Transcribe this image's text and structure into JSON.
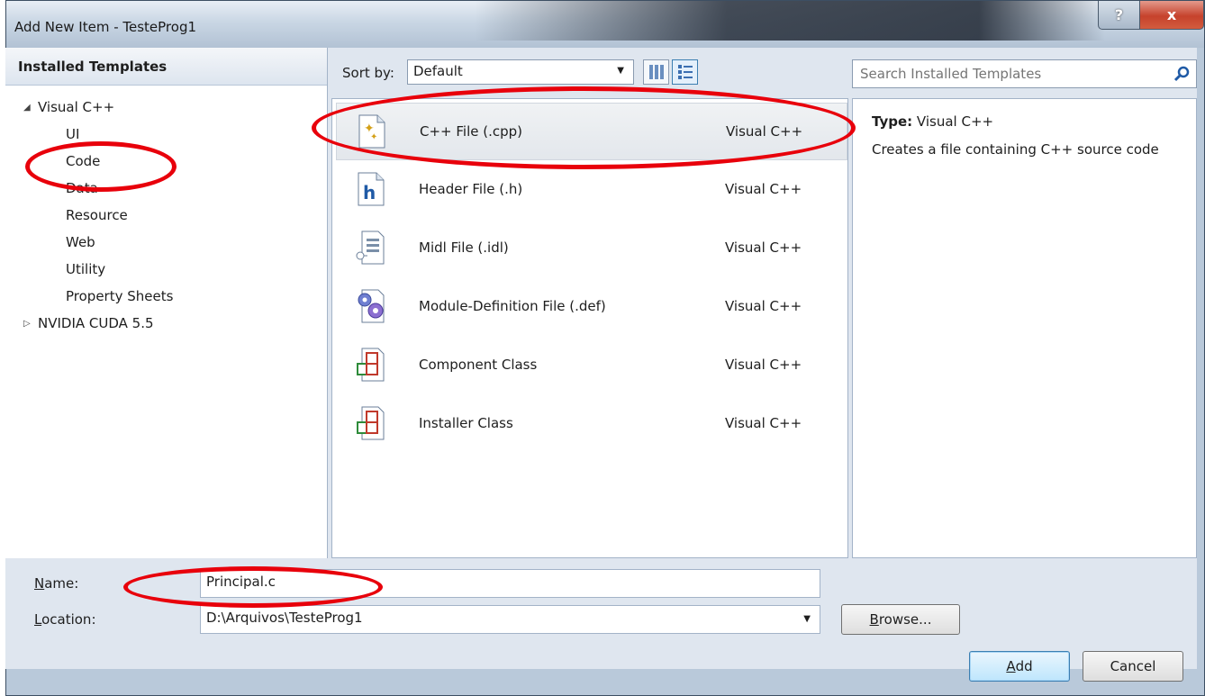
{
  "window": {
    "title": "Add New Item - TesteProg1",
    "help_glyph": "?",
    "close_glyph": "x"
  },
  "left": {
    "header": "Installed Templates",
    "tree": [
      {
        "label": "Visual C++",
        "arrow": "◢"
      },
      {
        "label": "UI"
      },
      {
        "label": "Code"
      },
      {
        "label": "Data"
      },
      {
        "label": "Resource"
      },
      {
        "label": "Web"
      },
      {
        "label": "Utility"
      },
      {
        "label": "Property Sheets"
      },
      {
        "label": "NVIDIA CUDA 5.5",
        "arrow": "▷"
      }
    ]
  },
  "sort": {
    "label": "Sort by:",
    "value": "Default"
  },
  "search": {
    "placeholder": "Search Installed Templates"
  },
  "templates": [
    {
      "name": "C++ File (.cpp)",
      "lang": "Visual C++",
      "icon": "cpp-file-icon"
    },
    {
      "name": "Header File (.h)",
      "lang": "Visual C++",
      "icon": "header-file-icon"
    },
    {
      "name": "Midl File (.idl)",
      "lang": "Visual C++",
      "icon": "midl-file-icon"
    },
    {
      "name": "Module-Definition File (.def)",
      "lang": "Visual C++",
      "icon": "def-file-icon"
    },
    {
      "name": "Component Class",
      "lang": "Visual C++",
      "icon": "component-class-icon"
    },
    {
      "name": "Installer Class",
      "lang": "Visual C++",
      "icon": "installer-class-icon"
    }
  ],
  "details": {
    "type_label": "Type:",
    "type_value": "Visual C++",
    "description": "Creates a file containing C++ source code"
  },
  "form": {
    "name_label_u": "N",
    "name_label_rest": "ame:",
    "name_value": "Principal.c",
    "location_label_u": "L",
    "location_label_rest": "ocation:",
    "location_value": "D:\\Arquivos\\TesteProg1"
  },
  "buttons": {
    "browse_u": "B",
    "browse_rest": "rowse...",
    "add_u": "A",
    "add_rest": "dd",
    "cancel": "Cancel"
  },
  "colors": {
    "annotation": "#e8000b",
    "accent": "#3c7fb1"
  }
}
